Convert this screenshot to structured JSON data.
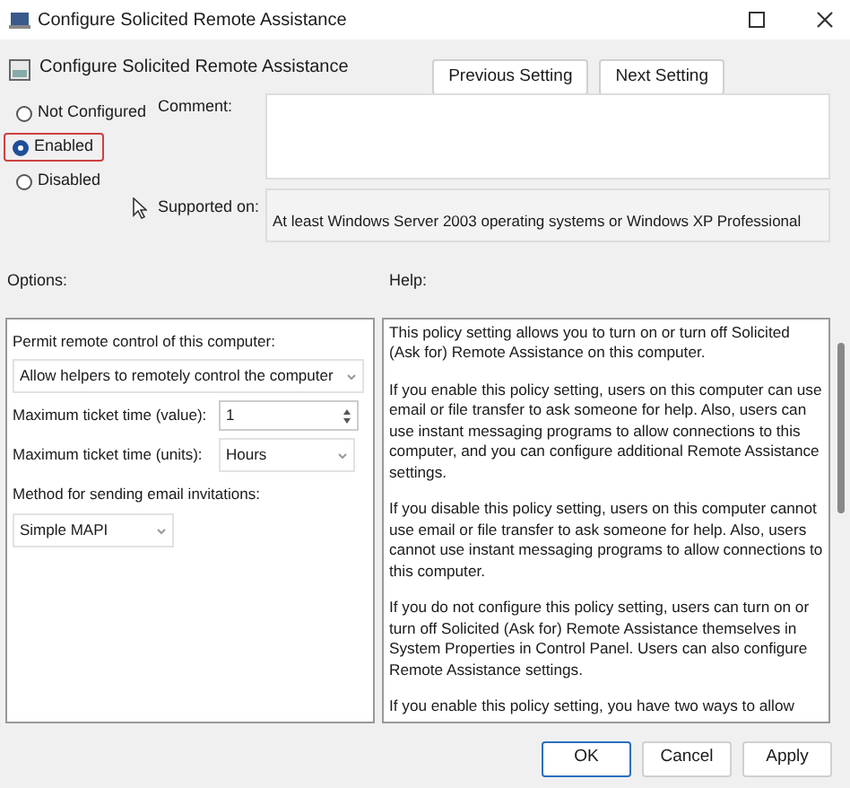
{
  "window": {
    "title": "Configure Solicited Remote Assistance"
  },
  "header": {
    "title": "Configure Solicited Remote Assistance",
    "buttons": [
      "Previous Setting",
      "Next Setting"
    ]
  },
  "states": [
    {
      "label": "Not Configured",
      "selected": false,
      "highlighted": false
    },
    {
      "label": "Enabled",
      "selected": true,
      "highlighted": true
    },
    {
      "label": "Disabled",
      "selected": false,
      "highlighted": false
    }
  ],
  "comment": {
    "label": "Comment:"
  },
  "supported_on": {
    "label": "Supported on:",
    "value": "At least Windows Server 2003 operating systems or Windows XP Professional"
  },
  "options": {
    "label": "Options:",
    "items": [
      {
        "kind": "label",
        "text": "Permit remote control of this computer:"
      },
      {
        "kind": "dropdown",
        "value": "Allow helpers to remotely control the computer"
      },
      {
        "kind": "spinner",
        "label": "Maximum ticket time (value):",
        "value": "1"
      },
      {
        "kind": "labeled_dropdown",
        "label": "Maximum ticket time (units):",
        "value": "Hours"
      },
      {
        "kind": "label",
        "text": "Method for sending email invitations:"
      },
      {
        "kind": "small_dropdown",
        "value": "Simple MAPI"
      }
    ]
  },
  "help": {
    "label": "Help:",
    "paragraphs": [
      "This policy setting allows you to turn on or turn off Solicited (Ask for) Remote Assistance on this computer.",
      "If you enable this policy setting, users on this computer can use email or file transfer to ask someone for help. Also, users can use instant messaging programs to allow connections to this computer, and you can configure additional Remote Assistance settings.",
      "If you disable this policy setting, users on this computer cannot use email or file transfer to ask someone for help. Also, users cannot use instant messaging programs to allow connections to this computer.",
      "If you do not configure this policy setting, users can turn on or turn off Solicited (Ask for) Remote Assistance themselves in System Properties in Control Panel. Users can also configure Remote Assistance settings.",
      "If you enable this policy setting, you have two ways to allow"
    ]
  },
  "buttons": [
    {
      "label": "OK",
      "default": true
    },
    {
      "label": "Cancel",
      "default": false
    },
    {
      "label": "Apply",
      "default": false
    }
  ]
}
